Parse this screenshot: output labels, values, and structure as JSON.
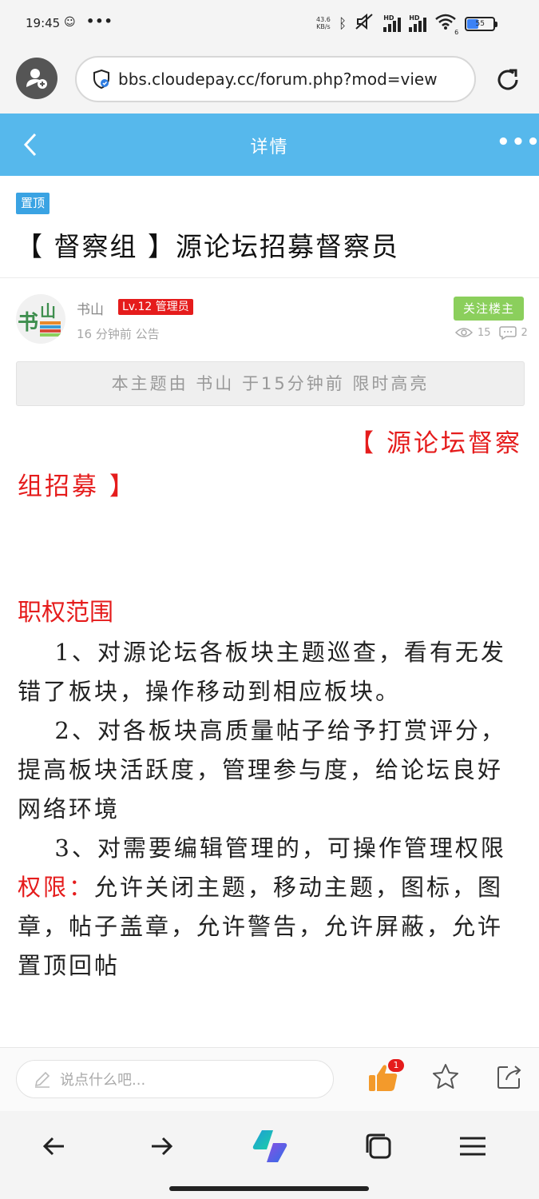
{
  "status_bar": {
    "time": "19:45",
    "dots": "•••",
    "net_speed_value": "43.6",
    "net_speed_unit": "KB/s",
    "hd1": "HD",
    "hd2": "HD",
    "wifi_sub": "6",
    "battery_percent": "55"
  },
  "browser": {
    "url": "bbs.cloudepay.cc/forum.php?mod=view"
  },
  "header": {
    "title": "详情"
  },
  "post": {
    "pin_label": "置顶",
    "title": "【 督察组 】源论坛招募督察员",
    "author_name": "书山",
    "author_level": "Lv.12 管理员",
    "meta": "16 分钟前 公告",
    "follow_label": "关注楼主",
    "views": "15",
    "replies": "2",
    "highlight_notice": "本主题由 书山 于15分钟前 限时高亮",
    "avatar_text_1": "书",
    "avatar_text_2": "山"
  },
  "article": {
    "recruit_line1": "【 源论坛督察",
    "recruit_line2": "组招募 】",
    "section_title": "职权范围",
    "paragraphs": [
      "1、对源论坛各板块主题巡查，看有无发错了板块，操作移动到相应板块。",
      "2、对各板块高质量帖子给予打赏评分，提高板块活跃度，管理参与度，给论坛良好网络环境",
      "3、对需要编辑管理的，可操作管理权限"
    ],
    "perm_label": "权限：",
    "perm_text": "允许关闭主题，移动主题，图标，图章，帖子盖章，允许警告，允许屏蔽，允许置顶回帖"
  },
  "comment_bar": {
    "placeholder": "说点什么吧...",
    "like_count": "1"
  },
  "colors": {
    "header_blue": "#56b8ec",
    "accent_red": "#e51c1c",
    "follow_green": "#8bcf5c",
    "pin_blue": "#3aa3e3"
  }
}
